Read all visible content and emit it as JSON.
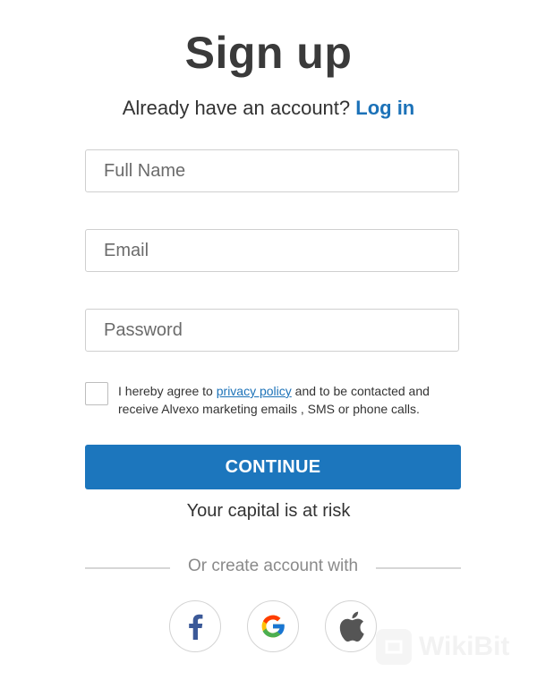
{
  "page": {
    "title": "Sign up",
    "login_prompt": "Already have an account?",
    "login_link": "Log in"
  },
  "form": {
    "full_name_placeholder": "Full Name",
    "email_placeholder": "Email",
    "password_placeholder": "Password",
    "agree_prefix": "I hereby agree to",
    "agree_link": "privacy policy",
    "agree_suffix": "and to be contacted and receive Alvexo marketing emails , SMS or phone calls.",
    "continue_label": "CONTINUE",
    "risk_notice": "Your capital is at risk"
  },
  "social": {
    "divider_text": "Or create account with",
    "providers": [
      {
        "name": "facebook-icon",
        "color": "#3b5998"
      },
      {
        "name": "google-icon",
        "color": "#4285f4"
      },
      {
        "name": "apple-icon",
        "color": "#555555"
      }
    ]
  },
  "watermark": {
    "text": "WikiBit"
  },
  "colors": {
    "accent": "#1c76bd",
    "link": "#1c72b8",
    "text": "#333333"
  }
}
